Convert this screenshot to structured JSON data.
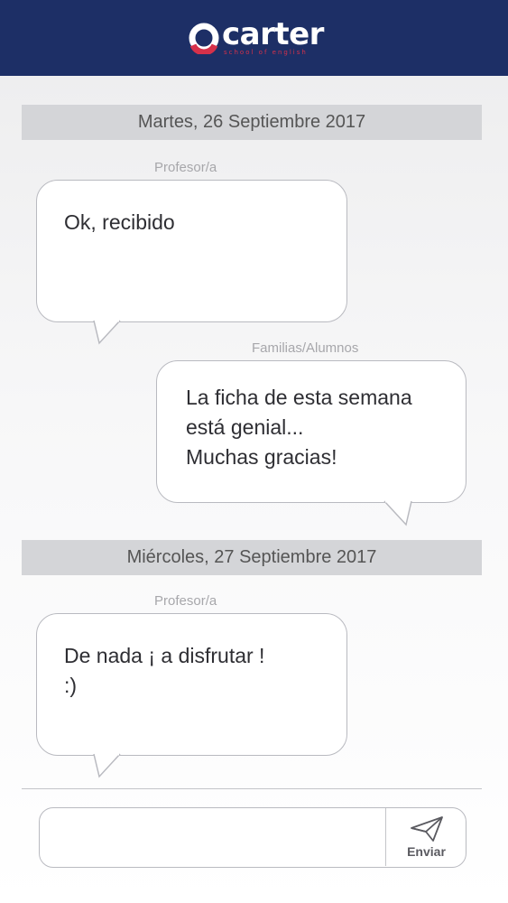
{
  "app": {
    "logo_text": "carter",
    "logo_subtitle": "school of english",
    "brand_color": "#1d2f66",
    "accent_color": "#d6314a"
  },
  "conversation": {
    "days": [
      {
        "date_label": "Martes, 26 Septiembre 2017",
        "messages": [
          {
            "sender": "Profesor/a",
            "side": "left",
            "text": "Ok, recibido"
          },
          {
            "sender": "Familias/Alumnos",
            "side": "right",
            "text": "La ficha de esta semana\nestá genial...\nMuchas gracias!"
          }
        ]
      },
      {
        "date_label": "Miércoles, 27 Septiembre 2017",
        "messages": [
          {
            "sender": "Profesor/a",
            "side": "left",
            "text": "De nada ¡ a disfrutar !\n:)"
          }
        ]
      }
    ]
  },
  "composer": {
    "input_value": "",
    "send_label": "Enviar",
    "send_icon": "paper-plane-icon"
  }
}
